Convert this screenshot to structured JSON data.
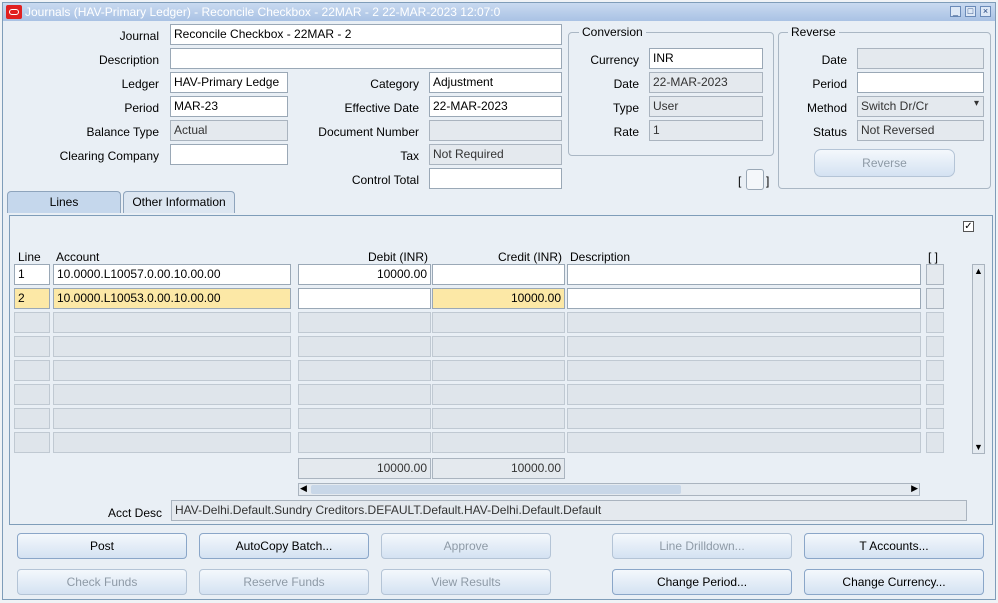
{
  "window": {
    "title": "Journals (HAV-Primary Ledger) - Reconcile Checkbox - 22MAR - 2 22-MAR-2023 12:07:0"
  },
  "header": {
    "journal_label": "Journal",
    "journal_value": "Reconcile Checkbox - 22MAR - 2",
    "description_label": "Description",
    "description_value": "",
    "ledger_label": "Ledger",
    "ledger_value": "HAV-Primary Ledge",
    "period_label": "Period",
    "period_value": "MAR-23",
    "balance_type_label": "Balance Type",
    "balance_type_value": "Actual",
    "clearing_company_label": "Clearing Company",
    "clearing_company_value": "",
    "category_label": "Category",
    "category_value": "Adjustment",
    "effective_date_label": "Effective Date",
    "effective_date_value": "22-MAR-2023",
    "document_number_label": "Document Number",
    "document_number_value": "",
    "tax_label": "Tax",
    "tax_value": "Not Required",
    "control_total_label": "Control Total",
    "control_total_value": ""
  },
  "conversion": {
    "title": "Conversion",
    "currency_label": "Currency",
    "currency_value": "INR",
    "date_label": "Date",
    "date_value": "22-MAR-2023",
    "type_label": "Type",
    "type_value": "User",
    "rate_label": "Rate",
    "rate_value": "1"
  },
  "reverse": {
    "title": "Reverse",
    "date_label": "Date",
    "date_value": "",
    "period_label": "Period",
    "period_value": "",
    "method_label": "Method",
    "method_value": "Switch Dr/Cr",
    "status_label": "Status",
    "status_value": "Not Reversed",
    "button": "Reverse"
  },
  "bracket_left": "[",
  "bracket_right": "]",
  "tabs": {
    "lines": "Lines",
    "other": "Other Information"
  },
  "lines": {
    "col_line": "Line",
    "col_account": "Account",
    "col_debit": "Debit (INR)",
    "col_credit": "Credit (INR)",
    "col_description": "Description",
    "col_flex": "[ ]",
    "rows": [
      {
        "line": "1",
        "account": "10.0000.L10057.0.00.10.00.00",
        "debit": "10000.00",
        "credit": "",
        "description": ""
      },
      {
        "line": "2",
        "account": "10.0000.L10053.0.00.10.00.00",
        "debit": "",
        "credit": "10000.00",
        "description": ""
      }
    ],
    "total_debit": "10000.00",
    "total_credit": "10000.00",
    "acct_desc_label": "Acct Desc",
    "acct_desc_value": "HAV-Delhi.Default.Sundry Creditors.DEFAULT.Default.HAV-Delhi.Default.Default"
  },
  "buttons": {
    "post": "Post",
    "autocopy": "AutoCopy Batch...",
    "approve": "Approve",
    "line_drilldown": "Line Drilldown...",
    "t_accounts": "T Accounts...",
    "check_funds": "Check Funds",
    "reserve_funds": "Reserve Funds",
    "view_results": "View Results",
    "change_period": "Change Period...",
    "change_currency": "Change Currency..."
  },
  "colors": {
    "highlight": "#fce8a6",
    "titlebar": "#a9c2e4",
    "logo": "#e02020"
  }
}
